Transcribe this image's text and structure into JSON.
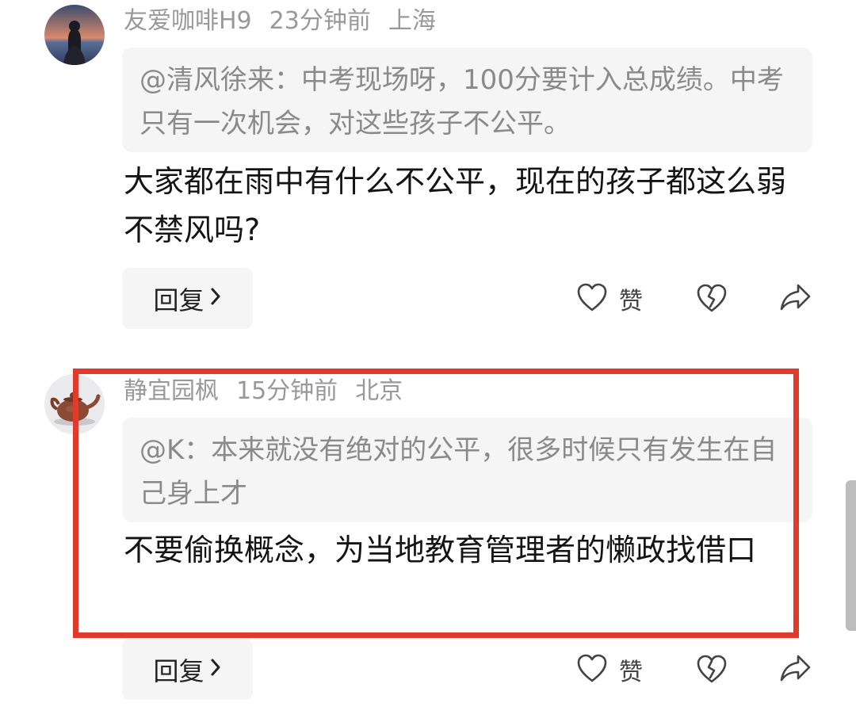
{
  "comments": [
    {
      "username": "友爱咖啡H9",
      "time": "23分钟前",
      "location": "上海",
      "quote": "@清风徐来：中考现场呀，100分要计入总成绩。中考只有一次机会，对这些孩子不公平。",
      "text": "大家都在雨中有什么不公平，现在的孩子都这么弱不禁风吗?",
      "reply_label": "回复",
      "like_label": "赞"
    },
    {
      "username": "静宜园枫",
      "time": "15分钟前",
      "location": "北京",
      "quote": "@K：本来就没有绝对的公平，很多时候只有发生在自己身上才",
      "text": "不要偷换概念，为当地教育管理者的懒政找借口",
      "reply_label": "回复",
      "like_label": "赞"
    }
  ],
  "colors": {
    "highlight_border": "#e03a2b",
    "meta_text": "#999999",
    "quote_bg": "#f5f5f5"
  },
  "icons": [
    "heart-icon",
    "broken-heart-icon",
    "share-icon",
    "chevron-right-icon"
  ]
}
